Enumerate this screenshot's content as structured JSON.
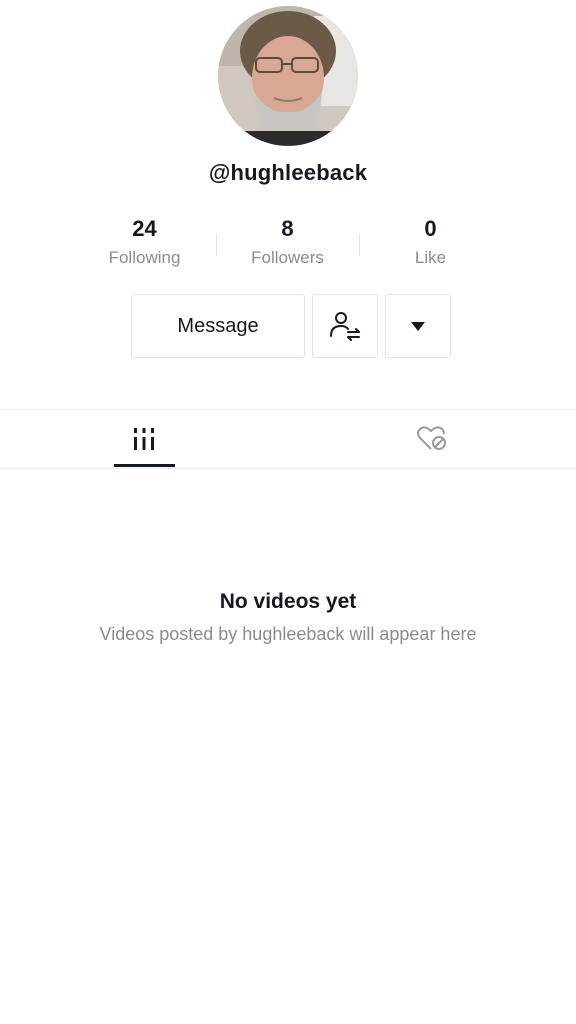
{
  "profile": {
    "username": "@hughleeback",
    "avatar_icon": "profile-photo"
  },
  "stats": [
    {
      "value": "24",
      "label": "Following"
    },
    {
      "value": "8",
      "label": "Followers"
    },
    {
      "value": "0",
      "label": "Like"
    }
  ],
  "actions": {
    "message_label": "Message",
    "follow_icon": "add-friend-icon",
    "more_icon": "dropdown-triangle-icon"
  },
  "tabs": [
    {
      "icon": "grid-icon",
      "selected": true
    },
    {
      "icon": "heart-lock-icon",
      "selected": false
    }
  ],
  "empty_state": {
    "title": "No videos yet",
    "subtitle": "Videos posted by hughleeback will appear here"
  },
  "colors": {
    "text_primary": "#161823",
    "text_secondary": "#8a8b91",
    "border": "#e3e3e4"
  }
}
